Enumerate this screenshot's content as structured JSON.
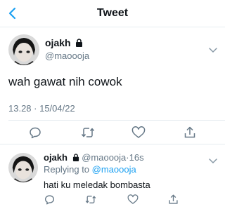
{
  "header": {
    "title": "Tweet",
    "back_icon": "chevron-left-icon"
  },
  "tweet": {
    "name": "ojakh",
    "handle": "@maoooja",
    "text": "wah gawat nih cowok",
    "timestamp": "13.28 · 15/04/22",
    "actions": [
      "reply-icon",
      "retweet-icon",
      "like-icon",
      "share-icon"
    ]
  },
  "reply": {
    "name": "ojakh",
    "handle": "@maoooja",
    "age": "16s",
    "replying_to_label": "Replying to",
    "replying_to_handle": "@maoooja",
    "text": "hati ku meledak bombasta",
    "actions": [
      "reply-icon",
      "retweet-icon",
      "like-icon",
      "share-icon"
    ]
  },
  "colors": {
    "accent": "#1da1f2",
    "muted": "#657786",
    "divider": "#e6ecf0",
    "text": "#0f1419"
  }
}
